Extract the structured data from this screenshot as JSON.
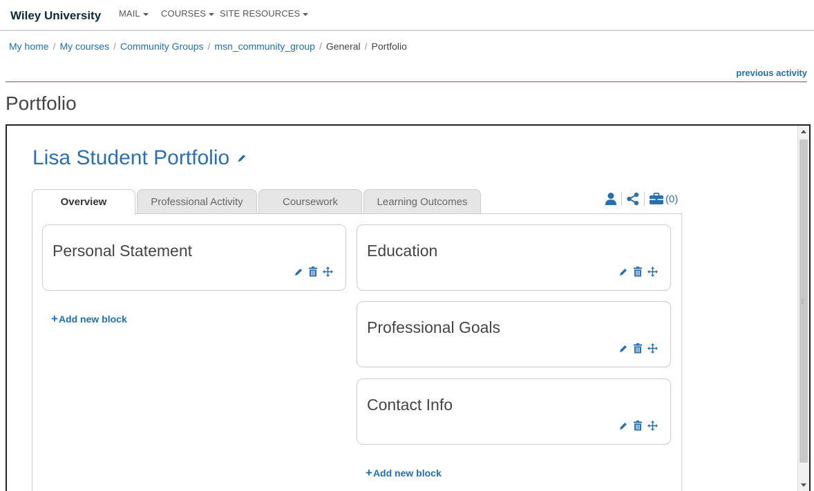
{
  "topnav": {
    "brand": "Wiley University",
    "menus": [
      {
        "label": "MAIL"
      },
      {
        "label": "COURSES"
      },
      {
        "label": "SITE RESOURCES"
      }
    ]
  },
  "breadcrumb": {
    "items": [
      "My home",
      "My courses",
      "Community Groups",
      "msn_community_group",
      "General",
      "Portfolio"
    ],
    "separator": "/"
  },
  "prev_activity": "previous activity",
  "page_title": "Portfolio",
  "portfolio": {
    "title": "Lisa Student Portfolio",
    "tabs": [
      "Overview",
      "Professional Activity",
      "Coursework",
      "Learning Outcomes"
    ],
    "active_tab": "Overview",
    "collection_count": "(0)",
    "left_column": {
      "blocks": [
        "Personal Statement"
      ],
      "add_label": "Add new block"
    },
    "right_column": {
      "blocks": [
        "Education",
        "Professional Goals",
        "Contact Info"
      ],
      "add_label": "Add new block"
    }
  },
  "colors": {
    "link": "#1f6fb2",
    "icon": "#2a6fb0",
    "rule": "#7a4f8c"
  }
}
